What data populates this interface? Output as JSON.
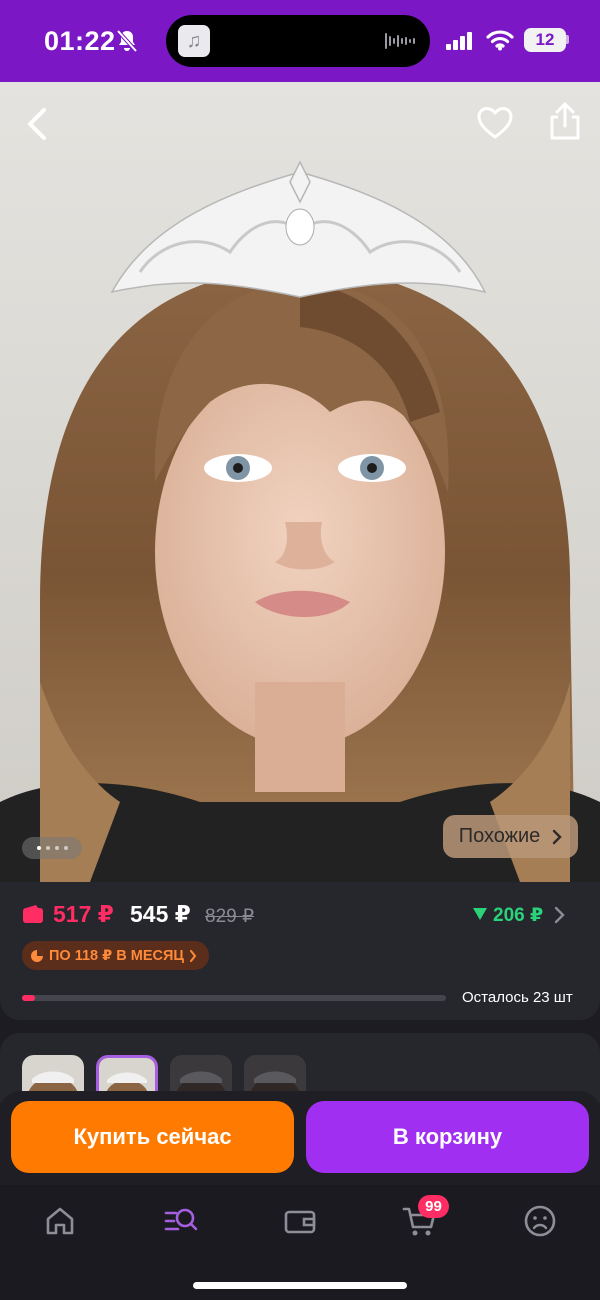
{
  "status_bar": {
    "time": "01:22",
    "battery": "12",
    "icons": [
      "bell-off-icon",
      "music-app-icon",
      "waveform-icon",
      "signal-icon",
      "wifi-icon",
      "battery-icon"
    ]
  },
  "hero": {
    "top_icons": [
      "back-icon",
      "heart-icon",
      "share-icon"
    ],
    "similar_label": "Похожие",
    "gallery_dots": 4,
    "gallery_active": 1
  },
  "price": {
    "wallet_price": "517 ₽",
    "price": "545 ₽",
    "old_price": "829 ₽",
    "price_drop": "206 ₽",
    "installment": "ПО 118 ₽ В МЕСЯЦ",
    "stock_label": "Осталось 23 шт",
    "stock_fill": 0.03
  },
  "variants": {
    "count": 4,
    "selected_index": 1
  },
  "actions": {
    "buy_now": "Купить сейчас",
    "to_cart": "В корзину"
  },
  "tabbar": {
    "items": [
      "home-icon",
      "catalog-search-icon",
      "wallet-icon",
      "cart-icon",
      "profile-icon"
    ],
    "active": 1,
    "cart_badge": "99"
  },
  "colors": {
    "status_bar": "#7b17c5",
    "accent_pink": "#ff2d63",
    "buy_now": "#ff7a00",
    "to_cart": "#a12ff1",
    "price_drop": "#2ad37a"
  }
}
